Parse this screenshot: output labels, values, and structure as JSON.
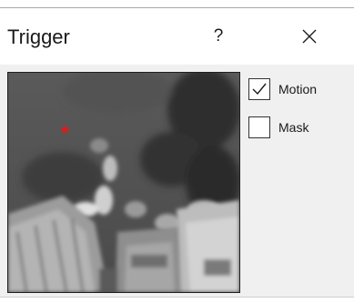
{
  "window": {
    "title": "Trigger",
    "help_label": "?",
    "close_icon": "close-icon",
    "colors": {
      "titlebar_bg": "#ffffff",
      "client_bg": "#f0f0f0",
      "motion_marker": "#d42020"
    }
  },
  "preview": {
    "icon": "camera-preview-image"
  },
  "options": [
    {
      "label": "Motion",
      "checked": true
    },
    {
      "label": "Mask",
      "checked": false
    }
  ]
}
